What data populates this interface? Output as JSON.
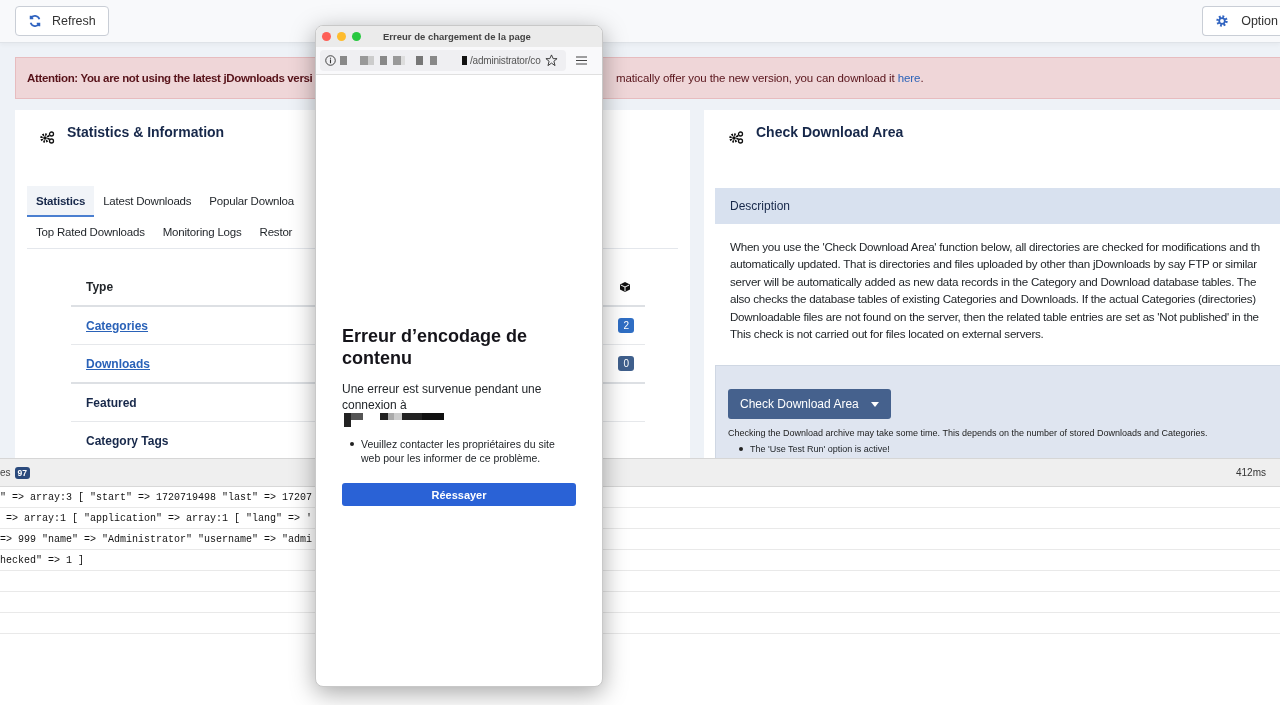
{
  "toolbar": {
    "refresh": "Refresh",
    "options": "Option"
  },
  "alert": {
    "start": "Attention: You are not using the latest jDownloads versi",
    "rest": "matically offer you the new version, you can download it ",
    "link": "here",
    "end": "."
  },
  "statistics_panel": {
    "title": "Statistics & Information",
    "tab_rows": [
      {
        "tabs": [
          {
            "label": "Statistics",
            "selected": true
          },
          {
            "label": "Latest Downloads",
            "selected": false
          },
          {
            "label": "Popular Downloa",
            "selected": false
          }
        ]
      },
      {
        "tabs": [
          {
            "label": "Top Rated Downloads",
            "selected": false
          },
          {
            "label": "Monitoring Logs",
            "selected": false
          },
          {
            "label": "Restor",
            "selected": false
          }
        ]
      }
    ],
    "table": {
      "columns": [
        "Type"
      ],
      "rows": [
        {
          "kind": "link",
          "label": "Categories",
          "count": "2",
          "color": "#2f6ec4"
        },
        {
          "kind": "link",
          "label": "Downloads",
          "count": "0",
          "color": "#3f5f8c"
        },
        {
          "kind": "plain",
          "label": "Featured"
        },
        {
          "kind": "plain",
          "label": "Category Tags"
        }
      ]
    }
  },
  "download_area_panel": {
    "title": "Check Download Area",
    "description_header": "Description",
    "description_lines": [
      "When you use the 'Check Download Area' function below, all directories are checked for modifications and th",
      "automatically updated. That is directories and files uploaded by other than jDownloads by say FTP or similar",
      "server will be automatically added as new data records in the Category and Download database tables. The",
      "also checks the database tables of existing Categories and Downloads. If the actual Categories (directories)",
      "Downloadable files are not found on the server, then the related table entries are set as 'Not published' in the",
      "This check is not carried out for files located on external servers."
    ],
    "button": "Check Download Area",
    "note": "Checking the Download archive may take some time. This depends on the number of stored Downloads and Categories.",
    "bullets": [
      "The 'Use Test Run' option is active!"
    ]
  },
  "debug_bar": {
    "tab": "es",
    "tab_count": "97",
    "time": "412ms",
    "lines": [
      "\" => array:3 [ \"start\" => 1720719498 \"last\" => 17207",
      " => array:1 [ \"application\" => array:1 [ \"lang\" => '",
      "=> 999 \"name\" => \"Administrator\" \"username\" => \"admi",
      "hecked\" => 1 ]"
    ]
  },
  "popup": {
    "title": "Erreur de chargement de la page",
    "url": "/administrator/co",
    "heading": "Erreur d’encodage de contenu",
    "message": "Une erreur est survenue pendant une connexion à",
    "bullets": [
      "Veuillez contacter les propriétaires du site web pour les informer de ce problème."
    ],
    "button": "Réessayer"
  }
}
